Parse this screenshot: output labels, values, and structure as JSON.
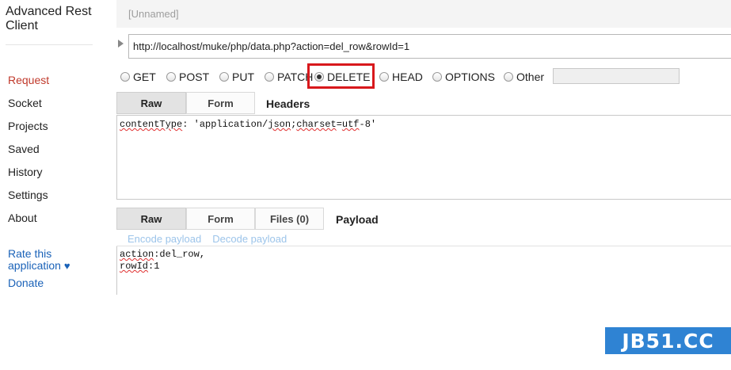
{
  "app": {
    "title": "Advanced Rest Client"
  },
  "sidebar": {
    "items": [
      {
        "label": "Request",
        "active": true
      },
      {
        "label": "Socket"
      },
      {
        "label": "Projects"
      },
      {
        "label": "Saved"
      },
      {
        "label": "History"
      },
      {
        "label": "Settings"
      },
      {
        "label": "About"
      }
    ],
    "rate_label": "Rate this",
    "rate_label2": "application",
    "heart": "♥",
    "donate_label": "Donate"
  },
  "request": {
    "name": "[Unnamed]",
    "url": "http://localhost/muke/php/data.php?action=del_row&rowId=1",
    "methods": [
      "GET",
      "POST",
      "PUT",
      "PATCH",
      "DELETE",
      "HEAD",
      "OPTIONS",
      "Other"
    ],
    "selected_method": "DELETE",
    "other_value": ""
  },
  "headers_editor": {
    "tabs": [
      "Raw",
      "Form"
    ],
    "active_tab": "Raw",
    "section_label": "Headers",
    "content_parts": [
      "contentType",
      ": 'application/",
      "json",
      ";",
      "charset",
      "=",
      "utf",
      "-8'"
    ]
  },
  "payload_editor": {
    "tabs": [
      "Raw",
      "Form",
      "Files (0)"
    ],
    "active_tab": "Raw",
    "section_label": "Payload",
    "encode_link": "Encode payload",
    "decode_link": "Decode payload",
    "lines": [
      {
        "key": "action",
        "rest": ":del_row,"
      },
      {
        "key": "rowId",
        "rest": ":1"
      }
    ]
  },
  "watermark": {
    "text": "JB51.CC"
  },
  "colors": {
    "accent_red": "#d8181c",
    "link_blue": "#1a62b8",
    "watermark_blue": "#2f83d3"
  }
}
